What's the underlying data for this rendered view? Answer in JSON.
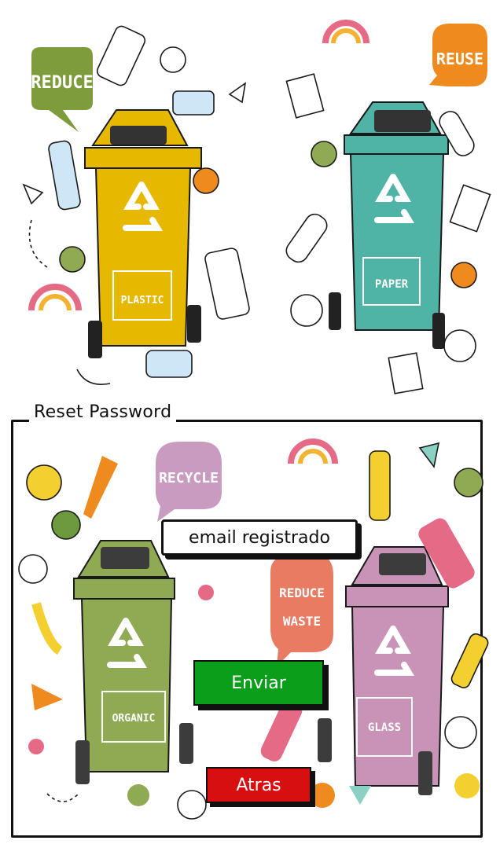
{
  "illustration_top": {
    "bins": [
      {
        "label": "PLASTIC",
        "color": "#e6b800"
      },
      {
        "label": "PAPER",
        "color": "#4fb3a6"
      }
    ],
    "bubbles": [
      {
        "text": "REDUCE",
        "color": "#7e9c3c"
      },
      {
        "text": "REUSE",
        "color": "#ef8a1f"
      }
    ]
  },
  "form": {
    "title": "Reset Password",
    "email_placeholder": "email registrado",
    "submit_label": "Enviar",
    "back_label": "Atras",
    "submit_color": "#0a9e1a",
    "back_color": "#d70f10"
  },
  "illustration_bottom": {
    "bins": [
      {
        "label": "ORGANIC",
        "color": "#8faa52"
      },
      {
        "label": "GLASS",
        "color": "#c893b6"
      }
    ],
    "bubbles": [
      {
        "text": "RECYCLE",
        "color": "#c99bc0"
      },
      {
        "text": "REDUCE WASTE",
        "color": "#ea7b63"
      }
    ]
  }
}
